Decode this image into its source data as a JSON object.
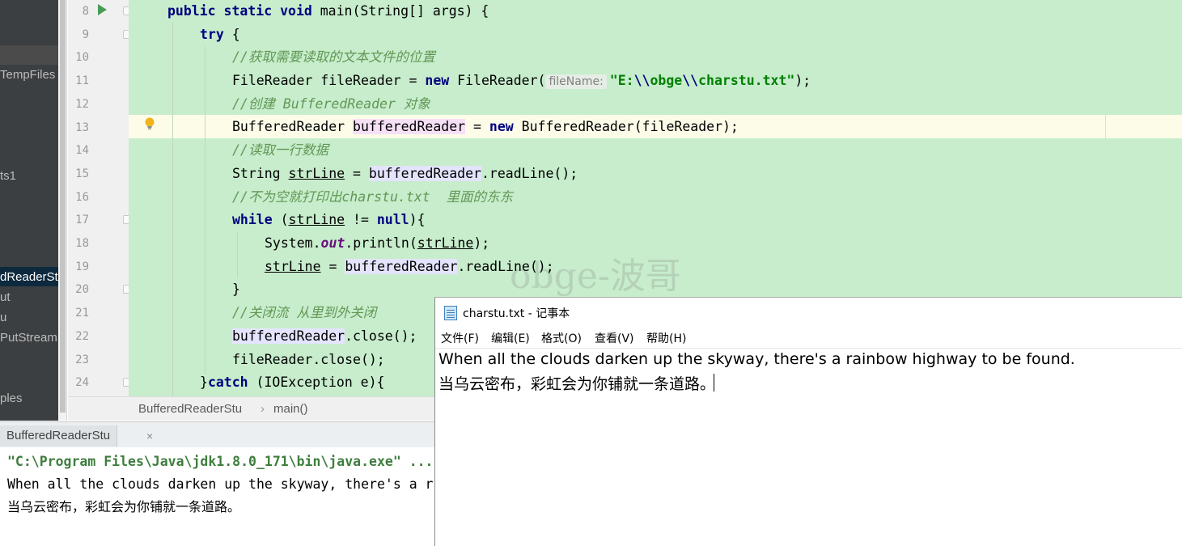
{
  "sidebar": {
    "items": [
      "TempFiles",
      "ts1",
      "dReaderStu",
      "ut",
      "u",
      "PutStreamS",
      "ples"
    ]
  },
  "editor": {
    "line_numbers": [
      "8",
      "9",
      "10",
      "11",
      "12",
      "13",
      "14",
      "15",
      "16",
      "17",
      "18",
      "19",
      "20",
      "21",
      "22",
      "23",
      "24"
    ],
    "watermark": "obge-波哥"
  },
  "code": {
    "l8_kw": "public static void ",
    "l8_rest": "main(String[] args) {",
    "l9_kw": "try",
    "l9_rest": " {",
    "l10": "//获取需要读取的文本文件的位置",
    "l11_a": "FileReader fileReader = ",
    "l11_new": "new",
    "l11_b": " FileReader(",
    "l11_hint": "fileName:",
    "l11_str1": "\"E:",
    "l11_esc1": "\\\\",
    "l11_str2": "obge",
    "l11_esc2": "\\\\",
    "l11_str3": "charstu.txt\"",
    "l11_end": ");",
    "l12": "//创建 BufferedReader 对象",
    "l13_a": "BufferedReader ",
    "l13_var": "bufferedReader",
    "l13_b": " = ",
    "l13_new": "new",
    "l13_c": " BufferedReader(fileReader);",
    "l14": "//读取一行数据",
    "l15_a": "String ",
    "l15_var": "strLine",
    "l15_b": " = ",
    "l15_br": "bufferedReader",
    "l15_c": ".readLine();",
    "l16": "//不为空就打印出charstu.txt  里面的东东",
    "l17_kw": "while",
    "l17_a": " (",
    "l17_var": "strLine",
    "l17_b": " != ",
    "l17_null": "null",
    "l17_c": "){",
    "l18_a": "System.",
    "l18_out": "out",
    "l18_b": ".println(",
    "l18_var": "strLine",
    "l18_c": ");",
    "l19_var": "strLine",
    "l19_a": " = ",
    "l19_br": "bufferedReader",
    "l19_b": ".readLine();",
    "l20": "}",
    "l21": "//关闭流 从里到外关闭",
    "l22_br": "bufferedReader",
    "l22_a": ".close();",
    "l23": "fileReader.close();",
    "l24_a": "}",
    "l24_kw": "catch",
    "l24_b": " (IOException e){"
  },
  "breadcrumb": {
    "class_name": "BufferedReaderStu",
    "separator": "›",
    "method": "main()"
  },
  "run_panel": {
    "tab_label": "BufferedReaderStu",
    "tab_close": "×",
    "command": "\"C:\\Program Files\\Java\\jdk1.8.0_171\\bin\\java.exe\" ...",
    "output_line1": "When all the clouds darken up the skyway, there's a r",
    "output_line2": "当乌云密布，彩虹会为你铺就一条道路。"
  },
  "notepad": {
    "title": "charstu.txt - 记事本",
    "menu": [
      "文件(F)",
      "编辑(E)",
      "格式(O)",
      "查看(V)",
      "帮助(H)"
    ],
    "line1": "When all the clouds darken up the skyway, there's a rainbow highway to be found.",
    "line2": "当乌云密布，彩虹会为你铺就一条道路。"
  },
  "colors": {
    "editor_bg": "#c7edcc",
    "keyword": "#000080",
    "comment": "#629755",
    "string": "#008000",
    "current_line": "#fcfce9"
  }
}
